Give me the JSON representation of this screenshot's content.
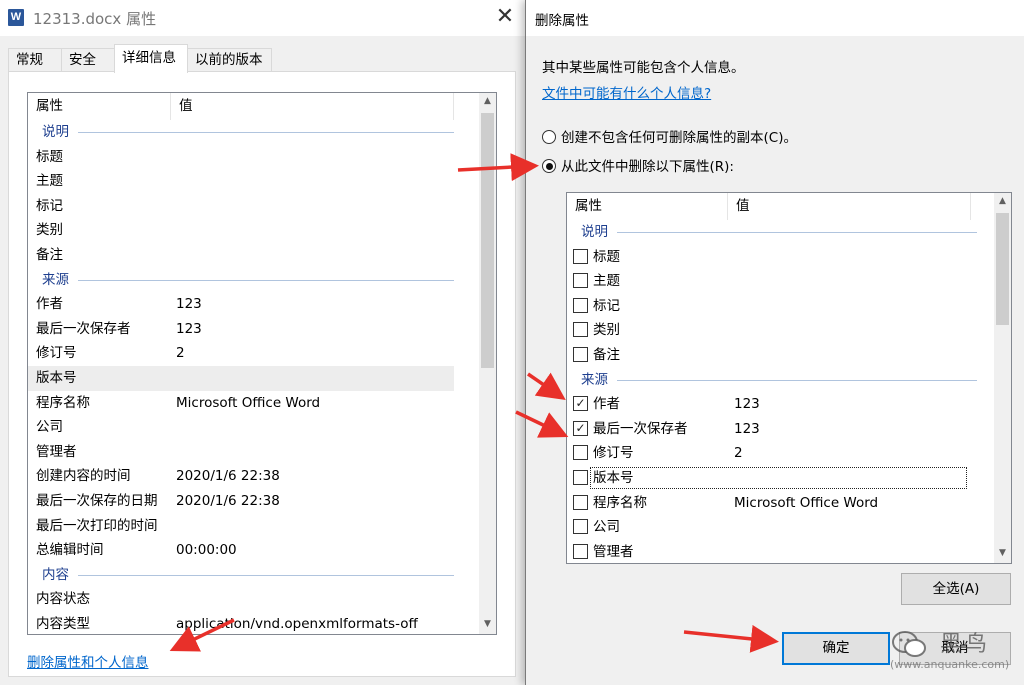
{
  "left_window": {
    "title": "12313.docx 属性",
    "close_glyph": "✕",
    "app_icon": "W",
    "tabs": [
      {
        "label": "常规"
      },
      {
        "label": "安全"
      },
      {
        "label": "详细信息"
      },
      {
        "label": "以前的版本"
      }
    ],
    "columns": {
      "property": "属性",
      "value": "值"
    },
    "rows": [
      {
        "type": "group",
        "name": "说明"
      },
      {
        "type": "item",
        "name": "标题",
        "value": ""
      },
      {
        "type": "item",
        "name": "主题",
        "value": ""
      },
      {
        "type": "item",
        "name": "标记",
        "value": ""
      },
      {
        "type": "item",
        "name": "类别",
        "value": ""
      },
      {
        "type": "item",
        "name": "备注",
        "value": ""
      },
      {
        "type": "group",
        "name": "来源"
      },
      {
        "type": "item",
        "name": "作者",
        "value": "123"
      },
      {
        "type": "item",
        "name": "最后一次保存者",
        "value": "123"
      },
      {
        "type": "item",
        "name": "修订号",
        "value": "2"
      },
      {
        "type": "item",
        "name": "版本号",
        "value": "",
        "highlight": true
      },
      {
        "type": "item",
        "name": "程序名称",
        "value": "Microsoft Office Word"
      },
      {
        "type": "item",
        "name": "公司",
        "value": ""
      },
      {
        "type": "item",
        "name": "管理者",
        "value": ""
      },
      {
        "type": "item",
        "name": "创建内容的时间",
        "value": "2020/1/6 22:38"
      },
      {
        "type": "item",
        "name": "最后一次保存的日期",
        "value": "2020/1/6 22:38"
      },
      {
        "type": "item",
        "name": "最后一次打印的时间",
        "value": ""
      },
      {
        "type": "item",
        "name": "总编辑时间",
        "value": "00:00:00"
      },
      {
        "type": "group",
        "name": "内容"
      },
      {
        "type": "item",
        "name": "内容状态",
        "value": ""
      },
      {
        "type": "item",
        "name": "内容类型",
        "value": "application/vnd.openxmlformats-off"
      }
    ],
    "remove_link": "删除属性和个人信息"
  },
  "right_window": {
    "title": "删除属性",
    "info_text": "其中某些属性可能包含个人信息。",
    "info_link": "文件中可能有什么个人信息?",
    "options": [
      {
        "label": "创建不包含任何可删除属性的副本(C)。",
        "selected": false
      },
      {
        "label": "从此文件中删除以下属性(R):",
        "selected": true
      }
    ],
    "columns": {
      "property": "属性",
      "value": "值"
    },
    "rows": [
      {
        "type": "group",
        "name": "说明"
      },
      {
        "type": "item",
        "name": "标题",
        "value": "",
        "checked": false
      },
      {
        "type": "item",
        "name": "主题",
        "value": "",
        "checked": false
      },
      {
        "type": "item",
        "name": "标记",
        "value": "",
        "checked": false
      },
      {
        "type": "item",
        "name": "类别",
        "value": "",
        "checked": false
      },
      {
        "type": "item",
        "name": "备注",
        "value": "",
        "checked": false
      },
      {
        "type": "group",
        "name": "来源"
      },
      {
        "type": "item",
        "name": "作者",
        "value": "123",
        "checked": true
      },
      {
        "type": "item",
        "name": "最后一次保存者",
        "value": "123",
        "checked": true
      },
      {
        "type": "item",
        "name": "修订号",
        "value": "2",
        "checked": false
      },
      {
        "type": "item",
        "name": "版本号",
        "value": "",
        "checked": false,
        "focus": true
      },
      {
        "type": "item",
        "name": "程序名称",
        "value": "Microsoft Office Word",
        "checked": false
      },
      {
        "type": "item",
        "name": "公司",
        "value": "",
        "checked": false
      },
      {
        "type": "item",
        "name": "管理者",
        "value": "",
        "checked": false
      }
    ],
    "select_all_button": "全选(A)",
    "ok_button": "确定",
    "cancel_button": "取消"
  },
  "watermark": {
    "name": "黑鸟",
    "url": "(www.anquanke.com)"
  },
  "colors": {
    "link": "#0066cc",
    "group_header": "#1e3f8f",
    "annotation_arrow": "#e8302a",
    "button_focus_border": "#0078d7"
  }
}
